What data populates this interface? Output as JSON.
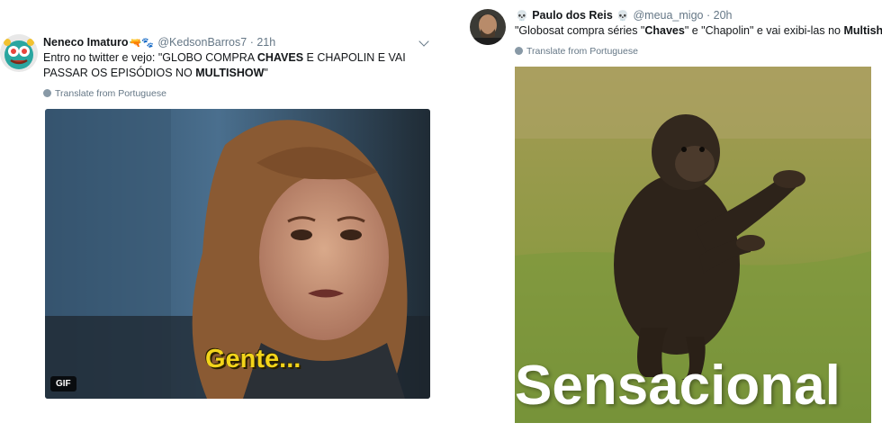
{
  "tweet1": {
    "name": "Neneco Imaturo",
    "name_emojis": "🔫🐾",
    "handle": "@KedsonBarros7",
    "separator": "·",
    "time": "21h",
    "text_part1": "Entro no twitter e vejo: \"GLOBO COMPRA ",
    "text_bold1": "CHAVES",
    "text_part2": " E CHAPOLIN E VAI PASSAR OS EPISÓDIOS NO ",
    "text_bold2": "MULTISHOW",
    "text_part3": "\"",
    "translate": "Translate from Portuguese",
    "media_caption": "Gente...",
    "media_badge": "GIF"
  },
  "tweet2": {
    "name": "Paulo dos Reis",
    "name_emoji_left": "💀",
    "name_emoji_right": "💀",
    "handle": "@meua_migo",
    "separator": "·",
    "time": "20h",
    "text_part1": "\"Globosat compra séries \"",
    "text_bold1": "Chaves",
    "text_part2": "\" e \"Chapolin\" e vai exibi-las no ",
    "text_bold2": "Multishow",
    "text_part3": "\"",
    "translate": "Translate from Portuguese",
    "media_caption": "Sensacional"
  },
  "icons": {
    "tweet_menu": "chevron-down-icon",
    "translate": "globe-icon"
  },
  "colors": {
    "meta_gray": "#657786",
    "text": "#14171a",
    "gif_caption_yellow": "#f3d41a"
  }
}
